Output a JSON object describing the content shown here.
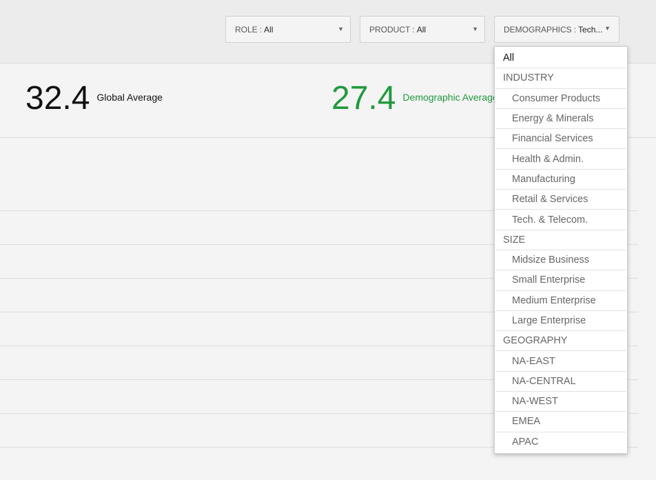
{
  "filters": {
    "role": {
      "label": "ROLE",
      "separator": ":",
      "value": "All"
    },
    "product": {
      "label": "PRODUCT",
      "separator": ":",
      "value": "All"
    },
    "demographics": {
      "label": "DEMOGRAPHICS",
      "separator": ":",
      "value": "Tech..."
    },
    "caret_glyph": "▼"
  },
  "stats": {
    "global": {
      "value": "32.4",
      "label": "Global Average",
      "color": "#111111"
    },
    "demographic": {
      "value": "27.4",
      "label": "Demographic Average",
      "color": "#1f9a3d"
    }
  },
  "dropdown": {
    "all": "All",
    "groups": [
      {
        "name": "INDUSTRY",
        "options": [
          "Consumer Products",
          "Energy & Minerals",
          "Financial Services",
          "Health & Admin.",
          "Manufacturing",
          "Retail & Services",
          "Tech. & Telecom."
        ]
      },
      {
        "name": "SIZE",
        "options": [
          "Midsize Business",
          "Small Enterprise",
          "Medium Enterprise",
          "Large Enterprise"
        ]
      },
      {
        "name": "GEOGRAPHY",
        "options": [
          "NA-EAST",
          "NA-CENTRAL",
          "NA-WEST",
          "EMEA",
          "APAC"
        ]
      }
    ]
  }
}
